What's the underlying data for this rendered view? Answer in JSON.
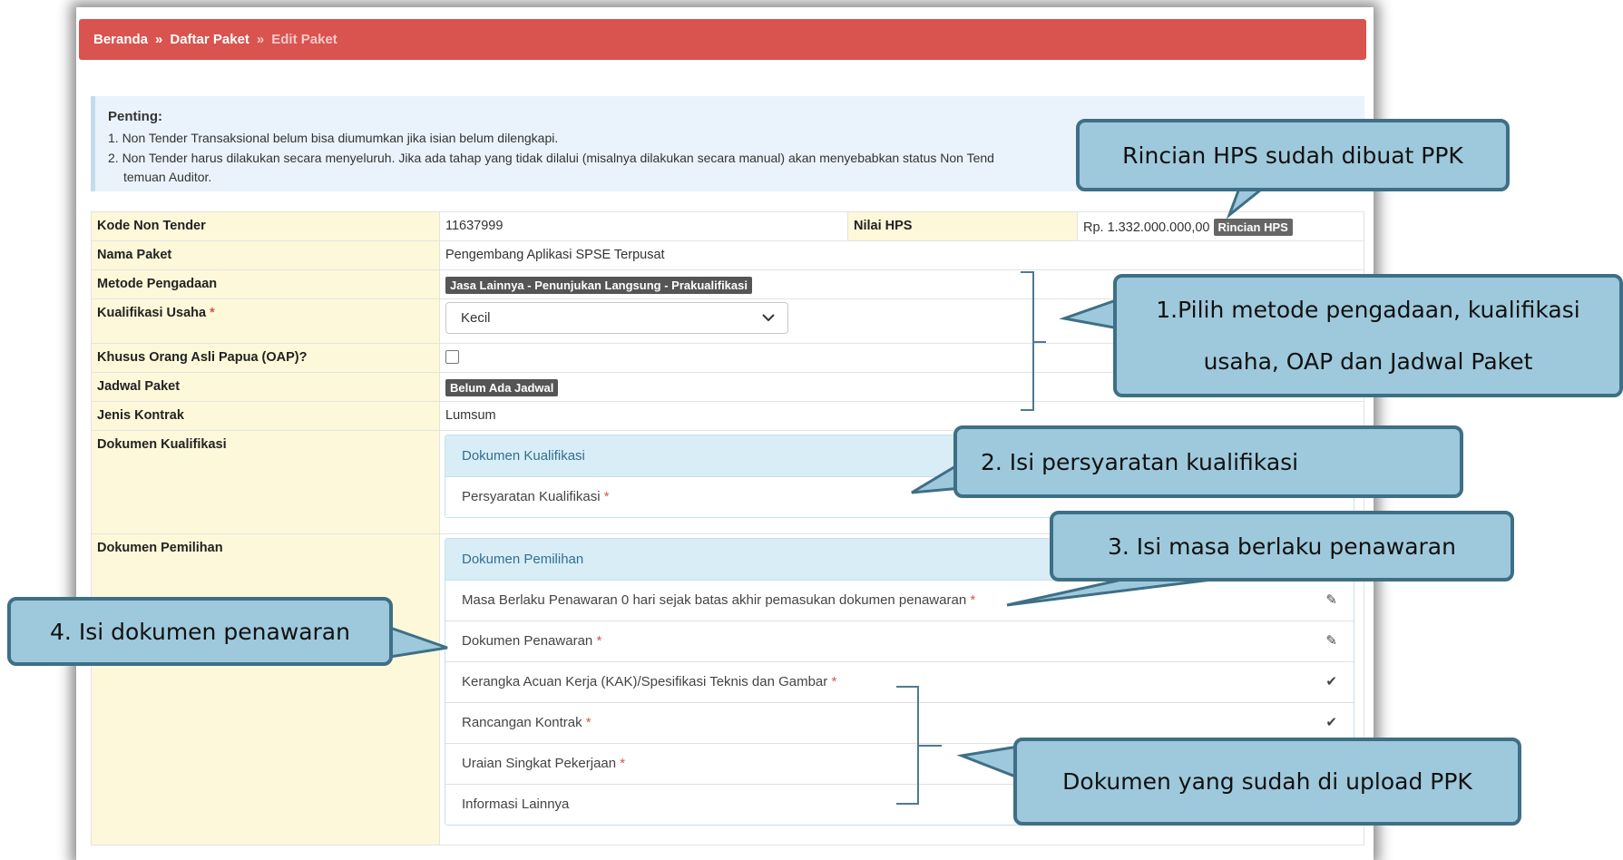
{
  "breadcrumb": {
    "home": "Beranda",
    "sep": "»",
    "list": "Daftar Paket",
    "current": "Edit Paket"
  },
  "alert": {
    "title": "Penting:",
    "line1": "1. Non Tender Transaksional belum bisa diumumkan jika isian belum dilengkapi.",
    "line2": "2. Non Tender harus dilakukan secara menyeluruh. Jika ada tahap yang tidak dilalui (misalnya dilakukan secara manual) akan menyebabkan status Non Tend",
    "line3": "temuan Auditor."
  },
  "form": {
    "kode_label": "Kode Non Tender",
    "kode_value": "11637999",
    "hps_label": "Nilai HPS",
    "hps_value": "Rp. 1.332.000.000,00",
    "hps_button": "Rincian HPS",
    "nama_label": "Nama Paket",
    "nama_value": "Pengembang Aplikasi SPSE Terpusat",
    "metode_label": "Metode Pengadaan",
    "metode_value": "Jasa Lainnya - Penunjukan Langsung - Prakualifikasi",
    "kualifikasi_label": "Kualifikasi Usaha",
    "required_mark": "*",
    "kualifikasi_value": "Kecil",
    "oap_label": "Khusus Orang Asli Papua (OAP)?",
    "jadwal_label": "Jadwal Paket",
    "jadwal_value": "Belum Ada Jadwal",
    "jenis_label": "Jenis Kontrak",
    "jenis_value": "Lumsum",
    "dokkual_label": "Dokumen Kualifikasi",
    "dokpil_label": "Dokumen Pemilihan"
  },
  "panel_kualifikasi": {
    "title": "Dokumen Kualifikasi",
    "item": "Persyaratan Kualifikasi"
  },
  "panel_pemilihan": {
    "title": "Dokumen Pemilihan",
    "items": [
      {
        "label": "Masa Berlaku Penawaran 0 hari sejak batas akhir pemasukan dokumen penawaran",
        "icon": "✎",
        "icon_name": "edit-icon"
      },
      {
        "label": "Dokumen Penawaran",
        "icon": "✎",
        "icon_name": "edit-icon"
      },
      {
        "label": "Kerangka Acuan Kerja (KAK)/Spesifikasi Teknis dan Gambar",
        "icon": "✔",
        "icon_name": "check-icon"
      },
      {
        "label": "Rancangan Kontrak",
        "icon": "✔",
        "icon_name": "check-icon"
      },
      {
        "label": "Uraian Singkat Pekerjaan",
        "icon": "",
        "icon_name": ""
      },
      {
        "label": "Informasi Lainnya",
        "icon": "",
        "icon_name": ""
      }
    ]
  },
  "callouts": {
    "hps": "Rincian HPS sudah dibuat PPK",
    "step1a": "1.Pilih metode pengadaan, kualifikasi",
    "step1b": "usaha, OAP dan Jadwal Paket",
    "step2": "2. Isi persyaratan kualifikasi",
    "step3": "3. Isi masa berlaku penawaran",
    "step4": "4. Isi dokumen penawaran",
    "uploaded": "Dokumen yang sudah di upload PPK"
  },
  "colors": {
    "header": "#d9534f",
    "label_bg": "#fdf8d9",
    "callout_bg": "#9ec9dc",
    "callout_border": "#3e6f86"
  }
}
